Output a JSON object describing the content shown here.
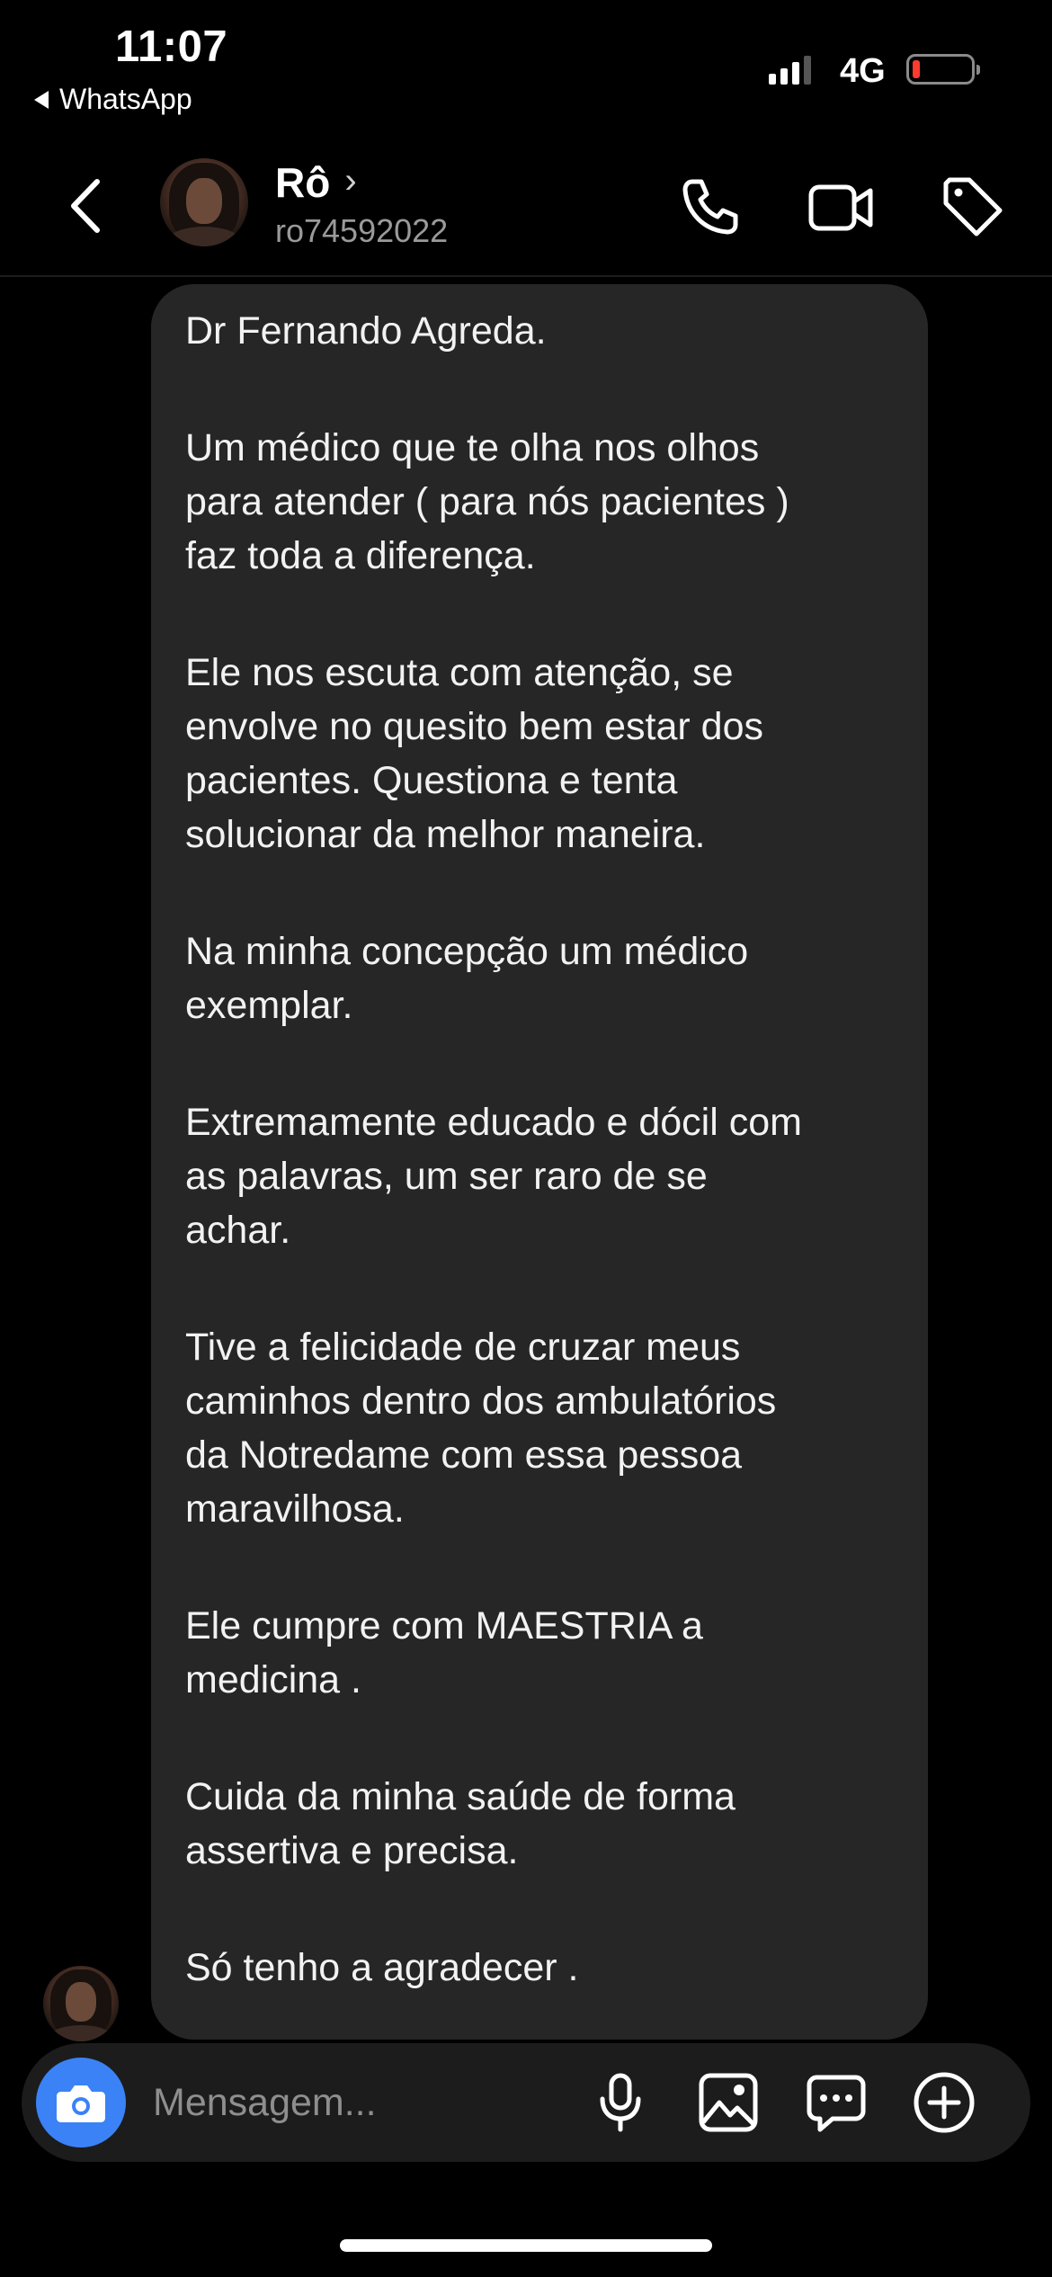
{
  "status_bar": {
    "time": "11:07",
    "back_app": "WhatsApp",
    "network": "4G",
    "signal_bars": 3,
    "battery_level": 0.08,
    "battery_color": "#ff3b30"
  },
  "header": {
    "contact_name": "Rô",
    "name_chevron": "›",
    "handle": "ro74592022",
    "icons": [
      "back-chevron-icon",
      "phone-icon",
      "video-camera-icon",
      "tag-icon"
    ]
  },
  "message": {
    "paragraphs": [
      "Dr Fernando Agreda.",
      "Um médico que te olha nos olhos\npara atender ( para nós pacientes )\nfaz toda a diferença.",
      "Ele nos  escuta com atenção, se\nenvolve no quesito bem estar dos\npacientes. Questiona e tenta\nsolucionar da melhor maneira.",
      "Na minha concepção um médico\nexemplar.",
      "Extremamente educado e dócil com\nas palavras, um ser raro de se\nachar.",
      "Tive a felicidade de cruzar meus\ncaminhos dentro dos ambulatórios\nda Notredame com essa pessoa\nmaravilhosa.",
      "Ele cumpre com MAESTRIA a\nmedicina .",
      "Cuida da minha saúde de forma\nassertiva e precisa.",
      "Só tenho a agradecer ."
    ]
  },
  "composer": {
    "placeholder": "Mensagem...",
    "icons": [
      "camera-icon",
      "microphone-icon",
      "gallery-icon",
      "sticker-chat-icon",
      "add-icon"
    ],
    "camera_color": "#3b82f6"
  }
}
